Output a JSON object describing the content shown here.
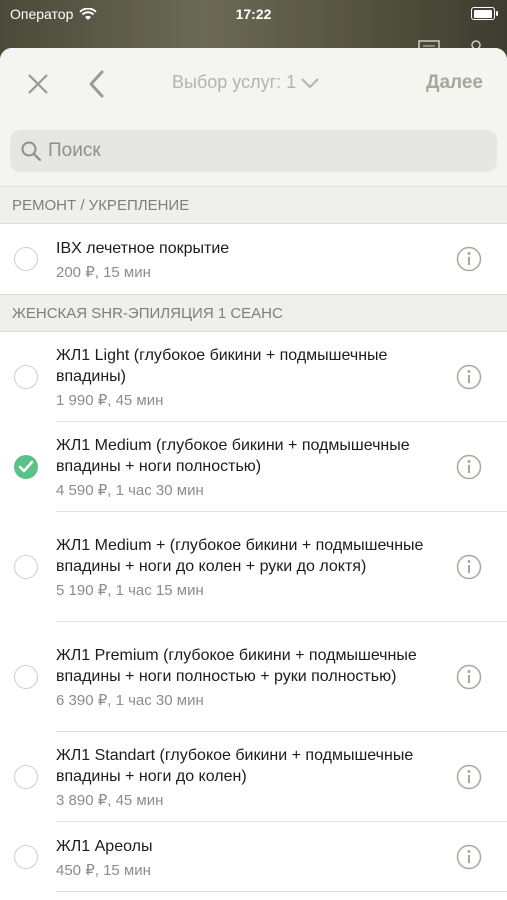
{
  "status_bar": {
    "carrier": "Оператор",
    "time": "17:22"
  },
  "navbar": {
    "title": "Выбор услуг: 1",
    "next_label": "Далее"
  },
  "search": {
    "placeholder": "Поиск"
  },
  "sections": [
    {
      "header": "РЕМОНТ / УКРЕПЛЕНИЕ",
      "items": [
        {
          "name": "IBX лечетное покрытие",
          "meta": "200 ₽,  15 мин",
          "checked": false
        }
      ]
    },
    {
      "header": "ЖЕНСКАЯ SHR-ЭПИЛЯЦИЯ 1 СЕАНС",
      "items": [
        {
          "name": "ЖЛ1 Light (глубокое бикини + подмышечные впадины)",
          "meta": "1 990 ₽,  45 мин",
          "checked": false
        },
        {
          "name": "ЖЛ1 Medium (глубокое бикини + подмышечные впадины + ноги полностью)",
          "meta": "4 590 ₽, 1 час 30 мин",
          "checked": true
        },
        {
          "name": "ЖЛ1 Medium + (глубокое бикини + подмышечные впадины + ноги до колен + руки до локтя)",
          "meta": "5 190 ₽, 1 час 15 мин",
          "checked": false
        },
        {
          "name": "ЖЛ1 Premium (глубокое бикини + подмышечные впадины + ноги полностью + руки полностью)",
          "meta": "6 390 ₽, 1 час 30 мин",
          "checked": false
        },
        {
          "name": "ЖЛ1 Standart (глубокое бикини + подмышечные впадины + ноги до колен)",
          "meta": "3 890 ₽,  45 мин",
          "checked": false
        },
        {
          "name": "ЖЛ1 Ареолы",
          "meta": "450 ₽,  15 мин",
          "checked": false
        }
      ]
    }
  ],
  "colors": {
    "accent_check": "#5bc287",
    "nav_text": "#a8a89a"
  },
  "icons": [
    "wifi-icon",
    "battery-icon",
    "close-icon",
    "chevron-left-icon",
    "chevron-down-icon",
    "search-icon",
    "info-icon",
    "checkmark-icon"
  ]
}
